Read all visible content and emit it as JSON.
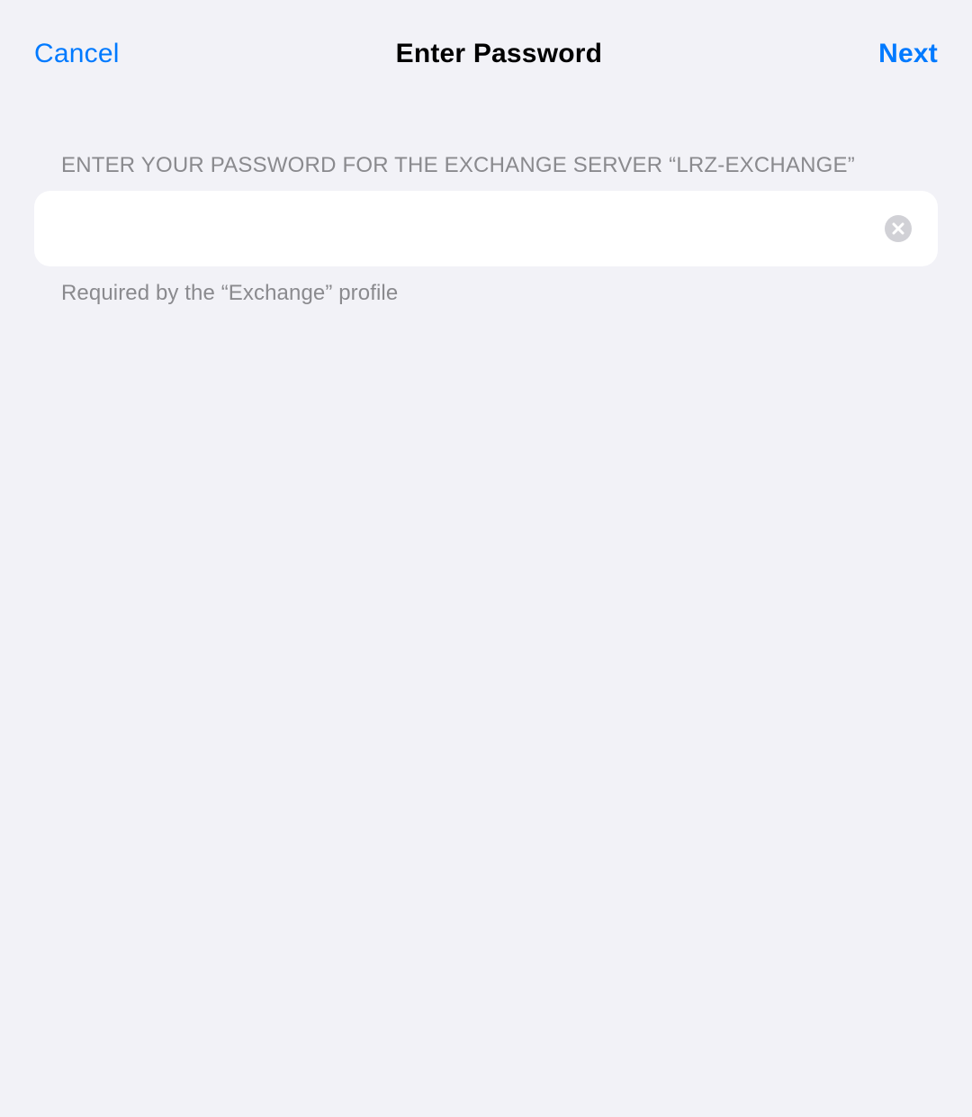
{
  "header": {
    "cancel_label": "Cancel",
    "title": "Enter Password",
    "next_label": "Next"
  },
  "section": {
    "header_text": "ENTER YOUR PASSWORD FOR THE EXCHANGE SERVER “LRZ-EXCHANGE”",
    "footer_text": "Required by the “Exchange” profile"
  },
  "password_field": {
    "value": "",
    "placeholder": ""
  },
  "icons": {
    "clear": "clear-circle-icon"
  }
}
